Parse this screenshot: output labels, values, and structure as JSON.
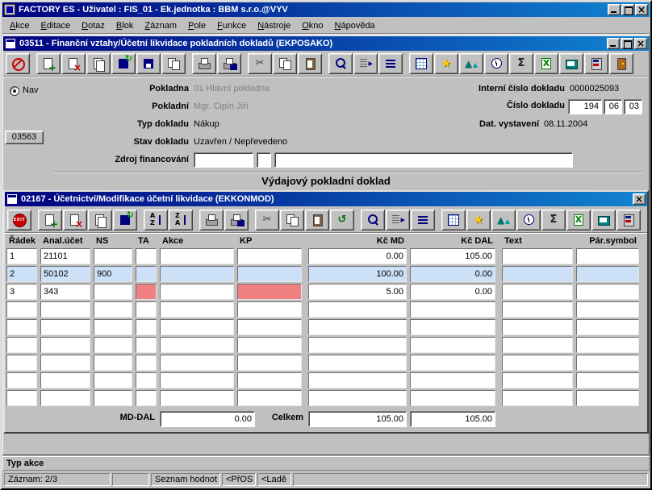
{
  "colors": {
    "title_from": "#000080",
    "title_to": "#1084d0",
    "window_face": "#c0c0c0",
    "selected_row_bg": "#cce0f7",
    "alert_cell_bg": "#f08080",
    "disabled_text": "#808080"
  },
  "app": {
    "title": "FACTORY ES - Uživatel : FIS_01 - Ek.jednotka : BBM s.r.o.@VYV",
    "menu": [
      "Akce",
      "Editace",
      "Dotaz",
      "Blok",
      "Záznam",
      "Pole",
      "Funkce",
      "Nástroje",
      "Okno",
      "Nápověda"
    ]
  },
  "window1": {
    "title": "03511 - Finanční vztahy/Účetní likvidace pokladních dokladů (EKPOSAKO)",
    "nav_label": "Nav",
    "form_number_button": "03563",
    "toolbar": [
      {
        "name": "cancel-button",
        "icon_name": "no-entry-icon",
        "icon": "tb-ban",
        "group": ""
      },
      {
        "name": "insert-record-button",
        "icon_name": "insert-record-icon",
        "icon": "tb-docplus",
        "group": "gs"
      },
      {
        "name": "delete-record-button",
        "icon_name": "delete-record-icon",
        "icon": "tb-docx",
        "group": ""
      },
      {
        "name": "copy-record-button",
        "icon_name": "copy-record-icon",
        "icon": "tb-docs",
        "group": ""
      },
      {
        "name": "save-refresh-button",
        "icon_name": "save-refresh-icon",
        "icon": "tb-diskarr",
        "group": ""
      },
      {
        "name": "save-button",
        "icon_name": "save-icon",
        "icon": "tb-disk",
        "group": ""
      },
      {
        "name": "duplicate-button",
        "icon_name": "duplicate-icon",
        "icon": "tb-copy",
        "group": ""
      },
      {
        "name": "print-button",
        "icon_name": "printer-icon",
        "icon": "tb-print",
        "group": "gs"
      },
      {
        "name": "print-preview-button",
        "icon_name": "print-preview-icon",
        "icon": "tb-printmag",
        "group": ""
      },
      {
        "name": "cut-button",
        "icon_name": "scissors-icon",
        "icon": "tb-cut",
        "group": "gs"
      },
      {
        "name": "copy-button",
        "icon_name": "copy-icon",
        "icon": "tb-copy",
        "group": ""
      },
      {
        "name": "paste-button",
        "icon_name": "paste-icon",
        "icon": "tb-paste",
        "group": ""
      },
      {
        "name": "search-button",
        "icon_name": "search-icon",
        "icon": "tb-mag",
        "group": "gs"
      },
      {
        "name": "execute-query-button",
        "icon_name": "execute-query-icon",
        "icon": "tb-query",
        "group": ""
      },
      {
        "name": "sort-button",
        "icon_name": "sort-icon",
        "icon": "tb-sort",
        "group": ""
      },
      {
        "name": "grid-button",
        "icon_name": "grid-icon",
        "icon": "tb-grid",
        "group": "gs"
      },
      {
        "name": "favorites-button",
        "icon_name": "star-icon",
        "icon": "tb-star",
        "group": ""
      },
      {
        "name": "chart-button",
        "icon_name": "chart-icon",
        "icon": "tb-chart",
        "group": ""
      },
      {
        "name": "timer-button",
        "icon_name": "clock-icon",
        "icon": "tb-clock",
        "group": ""
      },
      {
        "name": "sum-button",
        "icon_name": "sigma-icon",
        "icon": "tb-sigma",
        "group": ""
      },
      {
        "name": "excel-export-button",
        "icon_name": "excel-icon",
        "icon": "tb-excel",
        "group": ""
      },
      {
        "name": "notes-button",
        "icon_name": "notebook-icon",
        "icon": "tb-book",
        "group": ""
      },
      {
        "name": "calculator-button",
        "icon_name": "calculator-icon",
        "icon": "tb-calc",
        "group": ""
      },
      {
        "name": "exit-form-button",
        "icon_name": "door-icon",
        "icon": "tb-door",
        "group": ""
      }
    ],
    "labels": {
      "pokladna": "Pokladna",
      "pokladni": "Pokladní",
      "typ_dokladu": "Typ dokladu",
      "stav_dokladu": "Stav dokladu",
      "zdroj_financovani": "Zdroj financování",
      "interni_cislo": "Interní číslo dokladu",
      "cislo_dokladu": "Číslo dokladu",
      "dat_vystaveni": "Dat. vystavení"
    },
    "values": {
      "pokladna": "01 Hlavní pokladna",
      "pokladni": "Mgr. Cipín Jiří",
      "typ_dokladu": "Nákup",
      "stav_dokladu": "Uzavřen / Nepřevedeno",
      "interni_cislo": "0000025093",
      "cislo_dokladu_1": "194",
      "cislo_dokladu_2": "06",
      "cislo_dokladu_3": "03",
      "dat_vystaveni": "08.11.2004",
      "zdroj_financovani_1": "",
      "zdroj_financovani_2": "",
      "zdroj_financovani_3": ""
    },
    "heading": "Výdajový pokladní doklad"
  },
  "window2": {
    "title": "02167 - Účetnictví/Modifikace účetní likvidace (EKKONMOD)",
    "toolbar": [
      {
        "name": "exit-button",
        "icon_name": "exit-icon",
        "icon": "tb-exit",
        "group": ""
      },
      {
        "name": "insert-record-button",
        "icon_name": "insert-record-icon",
        "icon": "tb-docplus",
        "group": "gs"
      },
      {
        "name": "delete-record-button",
        "icon_name": "delete-record-icon",
        "icon": "tb-docx",
        "group": ""
      },
      {
        "name": "copy-record-button",
        "icon_name": "copy-record-icon",
        "icon": "tb-docs",
        "group": ""
      },
      {
        "name": "save-refresh-button",
        "icon_name": "save-refresh-icon",
        "icon": "tb-diskarr",
        "group": ""
      },
      {
        "name": "sort-asc-button",
        "icon_name": "sort-az-icon",
        "icon": "tb-sortaz",
        "group": "gs"
      },
      {
        "name": "sort-desc-button",
        "icon_name": "sort-za-icon",
        "icon": "tb-sortza",
        "group": ""
      },
      {
        "name": "print-button",
        "icon_name": "printer-icon",
        "icon": "tb-print",
        "group": "gs"
      },
      {
        "name": "print-preview-button",
        "icon_name": "print-preview-icon",
        "icon": "tb-printmag",
        "group": ""
      },
      {
        "name": "cut-button",
        "icon_name": "scissors-icon",
        "icon": "tb-cut",
        "group": "gs"
      },
      {
        "name": "copy-button",
        "icon_name": "copy-icon",
        "icon": "tb-copy",
        "group": ""
      },
      {
        "name": "paste-button",
        "icon_name": "paste-icon",
        "icon": "tb-paste",
        "group": ""
      },
      {
        "name": "undo-button",
        "icon_name": "undo-icon",
        "icon": "tb-undo",
        "group": ""
      },
      {
        "name": "search-button",
        "icon_name": "search-icon",
        "icon": "tb-mag",
        "group": "gs"
      },
      {
        "name": "execute-query-button",
        "icon_name": "execute-query-icon",
        "icon": "tb-query",
        "group": ""
      },
      {
        "name": "sort-button",
        "icon_name": "sort-icon",
        "icon": "tb-sort",
        "group": ""
      },
      {
        "name": "grid-button",
        "icon_name": "grid-icon",
        "icon": "tb-grid",
        "group": "gs"
      },
      {
        "name": "favorites-button",
        "icon_name": "star-icon",
        "icon": "tb-star",
        "group": ""
      },
      {
        "name": "chart-button",
        "icon_name": "chart-icon",
        "icon": "tb-chart",
        "group": ""
      },
      {
        "name": "timer-button",
        "icon_name": "clock-icon",
        "icon": "tb-clock",
        "group": ""
      },
      {
        "name": "sum-button",
        "icon_name": "sigma-icon",
        "icon": "tb-sigma",
        "group": ""
      },
      {
        "name": "excel-export-button",
        "icon_name": "excel-icon",
        "icon": "tb-excel",
        "group": ""
      },
      {
        "name": "notes-button",
        "icon_name": "notebook-icon",
        "icon": "tb-book",
        "group": ""
      },
      {
        "name": "calculator-button",
        "icon_name": "calculator-icon",
        "icon": "tb-calc",
        "group": ""
      }
    ],
    "table": {
      "headers": {
        "radek": "Řádek",
        "anal": "Anal.účet",
        "ns": "NS",
        "ta": "TA",
        "akce": "Akce",
        "kp": "KP",
        "md": "Kč MD",
        "dal": "Kč DAL",
        "text": "Text",
        "par": "Pár.symbol"
      },
      "rows": [
        {
          "radek": "1",
          "anal": "21101",
          "ns": "",
          "ta": "",
          "akce": "",
          "kp": "",
          "md": "0.00",
          "dal": "105.00",
          "text": "",
          "par": "",
          "row_class": "",
          "ta_class": "",
          "kp_class": ""
        },
        {
          "radek": "2",
          "anal": "50102",
          "ns": "900",
          "ta": "",
          "akce": "",
          "kp": "",
          "md": "100.00",
          "dal": "0.00",
          "text": "",
          "par": "",
          "row_class": "sel",
          "ta_class": "red",
          "kp_class": ""
        },
        {
          "radek": "3",
          "anal": "343",
          "ns": "",
          "ta": "",
          "akce": "",
          "kp": "",
          "md": "5.00",
          "dal": "0.00",
          "text": "",
          "par": "",
          "row_class": "",
          "ta_class": "red",
          "kp_class": "red"
        },
        {
          "radek": "",
          "anal": "",
          "ns": "",
          "ta": "",
          "akce": "",
          "kp": "",
          "md": "",
          "dal": "",
          "text": "",
          "par": "",
          "row_class": "",
          "ta_class": "",
          "kp_class": ""
        },
        {
          "radek": "",
          "anal": "",
          "ns": "",
          "ta": "",
          "akce": "",
          "kp": "",
          "md": "",
          "dal": "",
          "text": "",
          "par": "",
          "row_class": "",
          "ta_class": "",
          "kp_class": ""
        },
        {
          "radek": "",
          "anal": "",
          "ns": "",
          "ta": "",
          "akce": "",
          "kp": "",
          "md": "",
          "dal": "",
          "text": "",
          "par": "",
          "row_class": "",
          "ta_class": "",
          "kp_class": ""
        },
        {
          "radek": "",
          "anal": "",
          "ns": "",
          "ta": "",
          "akce": "",
          "kp": "",
          "md": "",
          "dal": "",
          "text": "",
          "par": "",
          "row_class": "",
          "ta_class": "",
          "kp_class": ""
        },
        {
          "radek": "",
          "anal": "",
          "ns": "",
          "ta": "",
          "akce": "",
          "kp": "",
          "md": "",
          "dal": "",
          "text": "",
          "par": "",
          "row_class": "",
          "ta_class": "",
          "kp_class": ""
        },
        {
          "radek": "",
          "anal": "",
          "ns": "",
          "ta": "",
          "akce": "",
          "kp": "",
          "md": "",
          "dal": "",
          "text": "",
          "par": "",
          "row_class": "",
          "ta_class": "",
          "kp_class": ""
        }
      ],
      "summary": {
        "md_dal_label": "MD-DAL",
        "md_dal_value": "0.00",
        "celkem_label": "Celkem",
        "celkem_md": "105.00",
        "celkem_dal": "105.00"
      }
    }
  },
  "statusbar": {
    "hint": "Typ akce",
    "segments": {
      "zaznam": "Záznam: 2/3",
      "seg2": "",
      "lov": "Seznam hodnot",
      "pros": "<PřOS",
      "lade": "<Ladě",
      "filler": ""
    }
  }
}
